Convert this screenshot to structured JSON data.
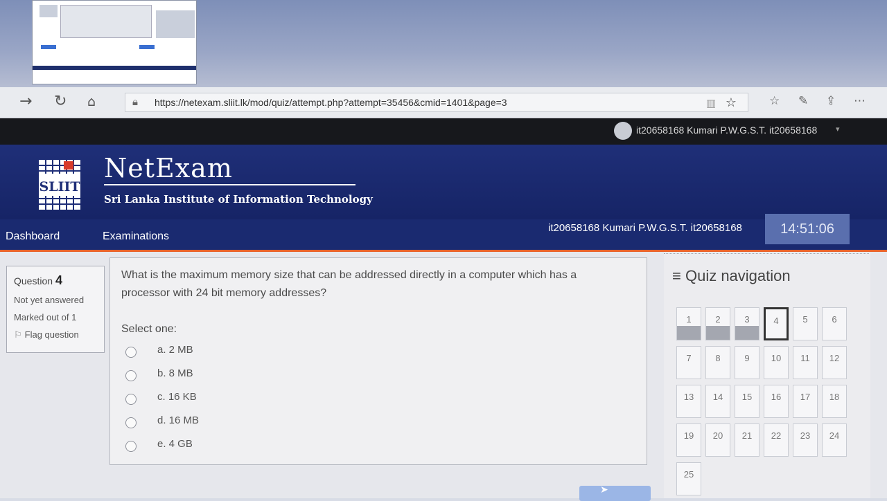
{
  "browser": {
    "url": "https://netexam.sliit.lk/mod/quiz/attempt.php?attempt=35456&cmid=1401&page=3"
  },
  "userbar": {
    "username": "it20658168 Kumari P.W.G.S.T. it20658168"
  },
  "banner": {
    "brand": "NetExam",
    "institute": "Sri Lanka Institute of Information Technology",
    "logo_text": "SLIIT"
  },
  "nav": {
    "dashboard": "Dashboard",
    "examinations": "Examinations",
    "user": "it20658168 Kumari P.W.G.S.T. it20658168",
    "timer": "14:51:06"
  },
  "question_info": {
    "label": "Question",
    "number": "4",
    "status": "Not yet answered",
    "marks": "Marked out of 1",
    "flag": "Flag question"
  },
  "question": {
    "text": "What is the maximum memory size that can be addressed directly in a computer which has a processor with 24 bit memory addresses?",
    "select_one": "Select one:",
    "options": [
      {
        "label": "a. 2 MB"
      },
      {
        "label": "b. 8 MB"
      },
      {
        "label": "c. 16 KB"
      },
      {
        "label": "d. 16 MB"
      },
      {
        "label": "e. 4 GB"
      }
    ]
  },
  "quiz_nav": {
    "title": "Quiz navigation",
    "current": 4,
    "answered": [
      1,
      2,
      3
    ],
    "questions": [
      "1",
      "2",
      "3",
      "4",
      "5",
      "6",
      "7",
      "8",
      "9",
      "10",
      "11",
      "12",
      "13",
      "14",
      "15",
      "16",
      "17",
      "18",
      "19",
      "20",
      "21",
      "22",
      "23",
      "24",
      "25"
    ]
  }
}
